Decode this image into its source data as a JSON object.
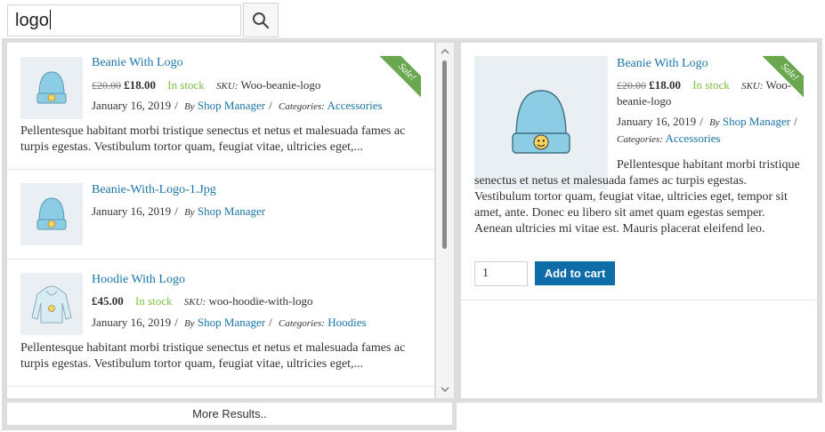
{
  "search": {
    "value": "logo"
  },
  "results": [
    {
      "title": "Beanie With Logo",
      "price_old": "£20.00",
      "price": "£18.00",
      "stock": "In stock",
      "sku_label": "SKU:",
      "sku": "Woo-beanie-logo",
      "date": "January 16, 2019",
      "by_label": "By",
      "author": "Shop Manager",
      "cat_label": "Categories:",
      "category": "Accessories",
      "desc": "Pellentesque habitant morbi tristique senectus et netus et malesuada fames ac turpis egestas. Vestibulum tortor quam, feugiat vitae, ultricies eget,...",
      "badge": "Sale!"
    },
    {
      "title": "Beanie-With-Logo-1.Jpg",
      "date": "January 16, 2019",
      "by_label": "By",
      "author": "Shop Manager"
    },
    {
      "title": "Hoodie With Logo",
      "price": "£45.00",
      "stock": "In stock",
      "sku_label": "SKU:",
      "sku": "woo-hoodie-with-logo",
      "date": "January 16, 2019",
      "by_label": "By",
      "author": "Shop Manager",
      "cat_label": "Categories:",
      "category": "Hoodies",
      "desc": "Pellentesque habitant morbi tristique senectus et netus et malesuada fames ac turpis egestas. Vestibulum tortor quam, feugiat vitae, ultricies eget,..."
    }
  ],
  "more": "More Results..",
  "detail": {
    "title": "Beanie With Logo",
    "price_old": "£20.00",
    "price": "£18.00",
    "stock": "In stock",
    "sku_label": "SKU:",
    "sku_a": "Woo-",
    "sku_b": "beanie-logo",
    "date": "January 16, 2019",
    "by_label": "By",
    "author": "Shop Manager",
    "cat_label": "Categories:",
    "category": "Accessories",
    "desc": "Pellentesque habitant morbi tristique senectus et netus et malesuada fames ac turpis egestas. Vestibulum tortor quam, feugiat vitae, ultricies eget, tempor sit amet, ante. Donec eu libero sit amet quam egestas semper. Aenean ultricies mi vitae est. Mauris placerat eleifend leo.",
    "badge": "Sale!",
    "qty": "1",
    "add_to_cart": "Add to cart"
  },
  "colors": {
    "accent": "#1b76a8",
    "stock": "#7ac142",
    "badge": "#6aa84f",
    "button": "#0e6ca8"
  }
}
